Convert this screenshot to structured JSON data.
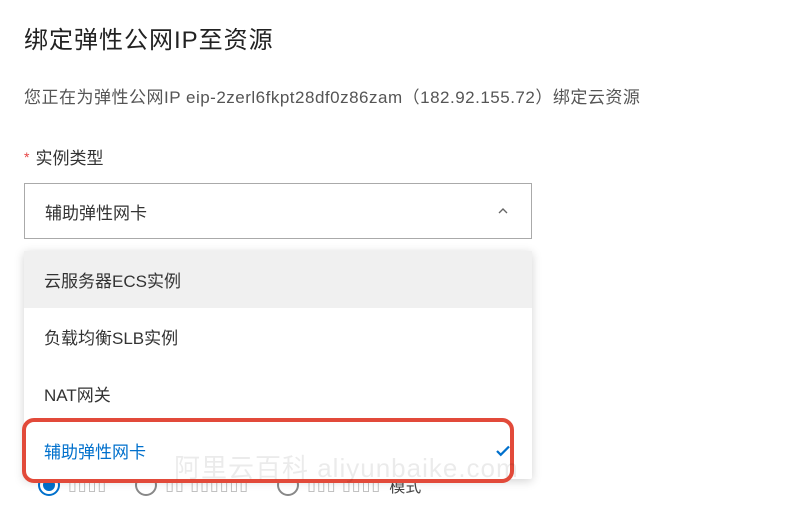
{
  "page": {
    "title": "绑定弹性公网IP至资源",
    "description_prefix": "您正在为弹性公网IP ",
    "eip_id": "eip-2zerl6fkpt28df0z86zam",
    "eip_ip": "（182.92.155.72）",
    "description_suffix": "绑定云资源"
  },
  "form": {
    "instance_type_label": "实例类型",
    "required_mark": "*"
  },
  "select": {
    "value": "辅助弹性网卡",
    "options": [
      {
        "label": "云服务器ECS实例",
        "selected": false,
        "hovered": true
      },
      {
        "label": "负载均衡SLB实例",
        "selected": false,
        "hovered": false
      },
      {
        "label": "NAT网关",
        "selected": false,
        "hovered": false
      },
      {
        "label": "辅助弹性网卡",
        "selected": true,
        "hovered": false,
        "highlighted": true
      }
    ]
  },
  "radio_row": {
    "option1_suffix": "模式",
    "watermark": "阿里云百科 aliyunbaike.com"
  }
}
